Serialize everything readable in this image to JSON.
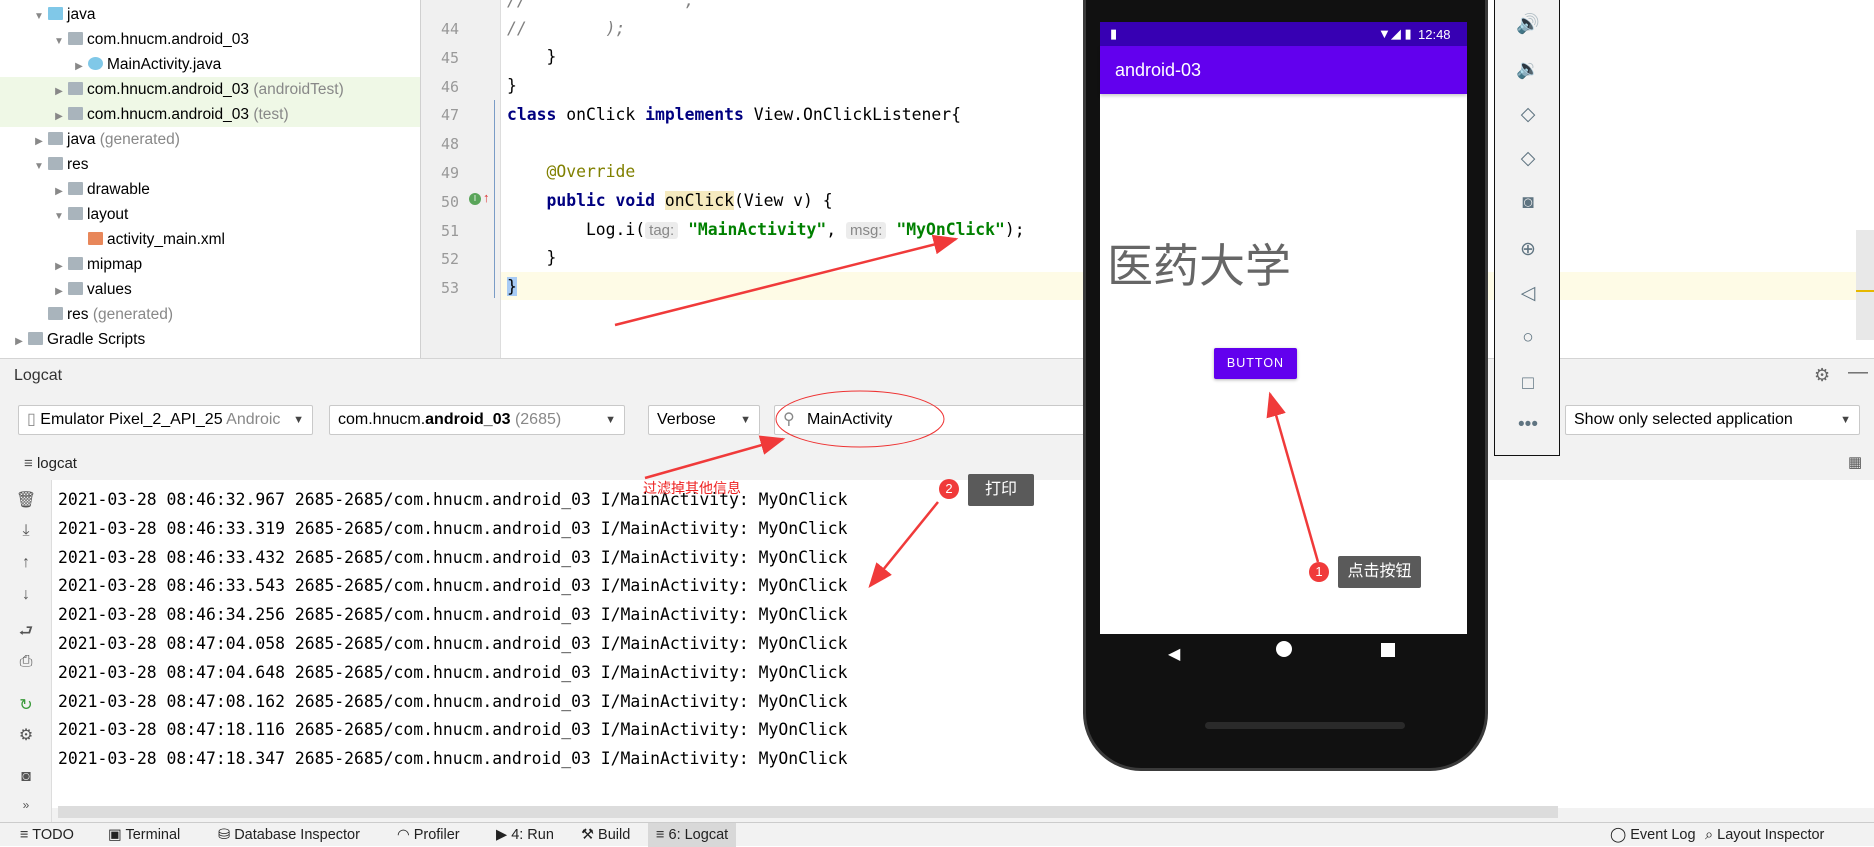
{
  "project_tree": [
    {
      "label": "java",
      "suffix": "",
      "indent": 1,
      "expanded": true,
      "icon": "folder-blue"
    },
    {
      "label": "com.hnucm.android_03",
      "suffix": "",
      "indent": 2,
      "expanded": true,
      "icon": "package"
    },
    {
      "label": "MainActivity.java",
      "suffix": "",
      "indent": 3,
      "expanded": false,
      "icon": "class"
    },
    {
      "label": "com.hnucm.android_03",
      "suffix": "(androidTest)",
      "indent": 2,
      "expanded": false,
      "icon": "package",
      "highlight": true
    },
    {
      "label": "com.hnucm.android_03",
      "suffix": "(test)",
      "indent": 2,
      "expanded": false,
      "icon": "package",
      "highlight": true
    },
    {
      "label": "java",
      "suffix": "(generated)",
      "indent": 1,
      "expanded": false,
      "icon": "folder-generated"
    },
    {
      "label": "res",
      "suffix": "",
      "indent": 1,
      "expanded": true,
      "icon": "res"
    },
    {
      "label": "drawable",
      "suffix": "",
      "indent": 2,
      "expanded": false,
      "icon": "folder"
    },
    {
      "label": "layout",
      "suffix": "",
      "indent": 2,
      "expanded": true,
      "icon": "folder"
    },
    {
      "label": "activity_main.xml",
      "suffix": "",
      "indent": 3,
      "expanded": null,
      "icon": "xml"
    },
    {
      "label": "mipmap",
      "suffix": "",
      "indent": 2,
      "expanded": false,
      "icon": "folder"
    },
    {
      "label": "values",
      "suffix": "",
      "indent": 2,
      "expanded": false,
      "icon": "folder"
    },
    {
      "label": "res",
      "suffix": "(generated)",
      "indent": 1,
      "expanded": null,
      "icon": "res"
    },
    {
      "label": "Gradle Scripts",
      "suffix": "",
      "indent": 0,
      "expanded": false,
      "icon": "gradle"
    }
  ],
  "editor": {
    "line_numbers": [
      "44",
      "45",
      "46",
      "47",
      "48",
      "49",
      "50",
      "51",
      "52",
      "53"
    ],
    "code": {
      "l44": "//        );",
      "l45": "    }",
      "l46": "}",
      "l47a": "class",
      "l47b": " onClick ",
      "l47c": "implements",
      "l47d": " View.OnClickListener{",
      "l49": "    @Override",
      "l50a": "    public void ",
      "l50b": "onClick",
      "l50c": "(View v) {",
      "l51a": "        Log.i(",
      "l51tag": "tag:",
      "l51s1": "\"MainActivity\"",
      "l51comma": ", ",
      "l51msg": "msg:",
      "l51s2": "\"MyOnClick\"",
      "l51end": ");",
      "l52": "    }",
      "l53": "}"
    }
  },
  "logcat": {
    "title": "Logcat",
    "device": "Emulator Pixel_2_API_25",
    "device_suffix": "Androic",
    "process_prefix": "com.hnucm.",
    "process_bold": "android_03",
    "process_pid": "(2685)",
    "level": "Verbose",
    "search_value": "MainActivity",
    "filter": "Show only selected application",
    "tab": "logcat",
    "lines": [
      "2021-03-28 08:46:32.967 2685-2685/com.hnucm.android_03 I/MainActivity: MyOnClick",
      "2021-03-28 08:46:33.319 2685-2685/com.hnucm.android_03 I/MainActivity: MyOnClick",
      "2021-03-28 08:46:33.432 2685-2685/com.hnucm.android_03 I/MainActivity: MyOnClick",
      "2021-03-28 08:46:33.543 2685-2685/com.hnucm.android_03 I/MainActivity: MyOnClick",
      "2021-03-28 08:46:34.256 2685-2685/com.hnucm.android_03 I/MainActivity: MyOnClick",
      "2021-03-28 08:47:04.058 2685-2685/com.hnucm.android_03 I/MainActivity: MyOnClick",
      "2021-03-28 08:47:04.648 2685-2685/com.hnucm.android_03 I/MainActivity: MyOnClick",
      "2021-03-28 08:47:08.162 2685-2685/com.hnucm.android_03 I/MainActivity: MyOnClick",
      "2021-03-28 08:47:18.116 2685-2685/com.hnucm.android_03 I/MainActivity: MyOnClick",
      "2021-03-28 08:47:18.347 2685-2685/com.hnucm.android_03 I/MainActivity: MyOnClick"
    ]
  },
  "phone": {
    "time": "12:48",
    "app_title": "android-03",
    "text": "医药大学",
    "button": "BUTTON",
    "colors": {
      "status": "#3700b3",
      "appbar": "#6200ee",
      "button": "#6200ee"
    }
  },
  "annotations": {
    "filter_note": "过滤掉其他信息",
    "callout1_num": "1",
    "callout1": "点击按钮",
    "callout2_num": "2",
    "callout2": "打印",
    "color": "#f03a3a"
  },
  "bottom_bar": {
    "todo": "TODO",
    "terminal": "Terminal",
    "db": "Database Inspector",
    "profiler": "Profiler",
    "run": "4: Run",
    "build": "Build",
    "logcat": "6: Logcat",
    "event_log": "Event Log",
    "layout_inspector": "Layout Inspector"
  }
}
